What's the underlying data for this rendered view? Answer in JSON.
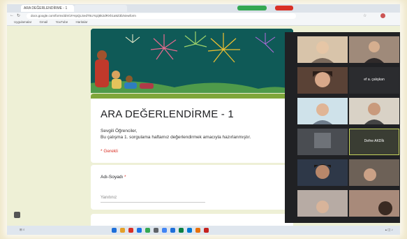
{
  "browser": {
    "tab_label": "ARA DEĞERLENDİRME - 1",
    "url": "docs.google.com/forms/d/e/1FAIpQLSedT5UYqzj8k2dRXh1a9Z3b/viewform",
    "bookmarks": [
      "Uygulamalar",
      "Gmail",
      "YouTube",
      "Haritalar"
    ]
  },
  "form": {
    "title": "ARA DEĞERLENDİRME - 1",
    "greeting": "Sevgili Öğrenciler,",
    "description": "Bu çalışma 1. sorgulama haftamız değerlendirmek amacıyla hazırlanmıştır.",
    "required_note": "* Gerekli",
    "question_label": "Adı-Soyadı",
    "question_required_mark": "*",
    "answer_placeholder": "Yanıtınız"
  },
  "meet": {
    "participants": [
      {
        "name": "",
        "tone": "#c9a98c"
      },
      {
        "name": "",
        "tone": "#8c7466"
      },
      {
        "name": "",
        "tone": "#3b2c27"
      },
      {
        "name": "ef a. çalışkan",
        "tone": "#2b2c2f"
      },
      {
        "name": "",
        "tone": "#bfa791"
      },
      {
        "name": "",
        "tone": "#8a6a5a"
      },
      {
        "name": "",
        "tone": "#4a4d52"
      },
      {
        "name": "Defne AKDİk",
        "tone": "#3a3d33"
      },
      {
        "name": "",
        "tone": "#2e3848"
      },
      {
        "name": "",
        "tone": "#5a4e45"
      },
      {
        "name": "",
        "tone": "#9a8c86"
      },
      {
        "name": "",
        "tone": "#8f6f5f"
      },
      {
        "name": "",
        "tone": "#6a6f75"
      },
      {
        "name": "",
        "tone": "#a28570"
      }
    ]
  },
  "taskbar": {
    "icons": [
      "#1e6fd9",
      "#e4a02a",
      "#d93025",
      "#1a73e8",
      "#34a853",
      "#5f6368",
      "#4285f4",
      "#1e6fd9",
      "#0b8043",
      "#0078d4",
      "#e8710a",
      "#c5221f"
    ]
  },
  "colors": {
    "header": "#0f5a57",
    "accent": "#7fa63a",
    "required": "#d93025"
  }
}
